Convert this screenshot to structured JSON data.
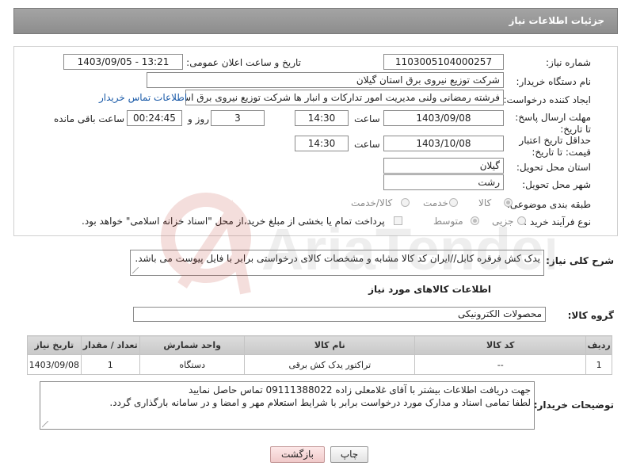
{
  "header": {
    "title": "جزئیات اطلاعات نیاز"
  },
  "form": {
    "need_number_label": "شماره نیاز:",
    "need_number": "1103005104000257",
    "announce_label": "تاریخ و ساعت اعلان عمومی:",
    "announce_value": "1403/09/05 - 13:21",
    "buyer_org_label": "نام دستگاه خریدار:",
    "buyer_org": "شرکت توزیع نیروی برق استان گیلان",
    "requester_label": "ایجاد کننده درخواست:",
    "requester": "فرشته رمضانی ولنی مدیریت امور تدارکات و انبار ها شرکت توزیع نیروی برق استا",
    "contact_link": "اطلاعات تماس خریدار",
    "deadline_label": "مهلت ارسال پاسخ: تا تاریخ:",
    "deadline_date": "1403/09/08",
    "time_label": "ساعت",
    "deadline_time": "14:30",
    "days_count": "3",
    "days_label": "روز و",
    "remaining_time": "00:24:45",
    "remaining_label": "ساعت باقی مانده",
    "validity_label": "حداقل تاریخ اعتبار قیمت: تا تاریخ:",
    "validity_date": "1403/10/08",
    "validity_time": "14:30",
    "province_label": "استان محل تحویل:",
    "province": "گیلان",
    "city_label": "شهر محل تحویل:",
    "city": "رشت",
    "category_label": "طبقه بندی موضوعی:",
    "category_options": [
      "کالا",
      "خدمت",
      "کالا/خدمت"
    ],
    "process_label": "نوع فرآیند خرید :",
    "process_options": [
      "جزیی",
      "متوسط"
    ],
    "payment_note": "پرداخت تمام یا بخشی از مبلغ خرید،از محل \"اسناد خزانه اسلامی\" خواهد بود."
  },
  "description": {
    "label": "شرح کلی نیاز:",
    "text": "یدک کش فرقره کابل//ایران کد کالا مشابه و مشخصات کالای درخواستی برابر با فایل پیوست می باشد."
  },
  "goods": {
    "section_title": "اطلاعات کالاهای مورد نیاز",
    "group_label": "گروه کالا:",
    "group_value": "محصولات الکترونیکی",
    "columns": [
      "ردیف",
      "کد کالا",
      "نام کالا",
      "واحد شمارش",
      "تعداد / مقدار",
      "تاریخ نیاز"
    ],
    "rows": [
      {
        "row": "1",
        "code": "--",
        "name": "تراکتور یدک کش برقی",
        "unit": "دستگاه",
        "qty": "1",
        "date": "1403/09/08"
      }
    ]
  },
  "buyer_notes": {
    "label": "توضیحات خریدار:",
    "line1": "جهت دریافت اطلاعات بیشتر با آقای غلامعلی زاده 09111388022 تماس حاصل نمایید",
    "line2": "لطفا تمامی اسناد و مدارک مورد درخواست برابر با شرایط استعلام مهر و امضا و در سامانه بارگذاری گردد."
  },
  "buttons": {
    "print": "چاپ",
    "back": "بازگشت"
  },
  "watermark": {
    "text": "AriaTender.neT"
  }
}
